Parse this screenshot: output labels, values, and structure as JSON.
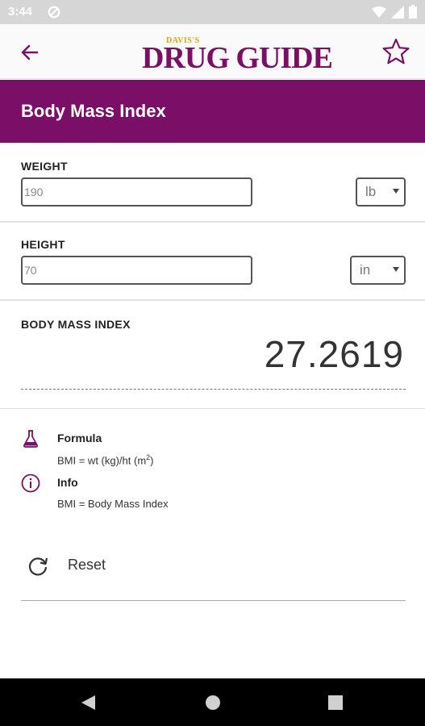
{
  "status_bar": {
    "time": "3:44"
  },
  "app_bar": {
    "logo_small": "DAVIS'S",
    "logo_main": "DRUG GUIDE"
  },
  "page": {
    "title": "Body Mass Index"
  },
  "weight": {
    "label": "WEIGHT",
    "value": "190",
    "unit": "lb"
  },
  "height": {
    "label": "HEIGHT",
    "value": "70",
    "unit": "in"
  },
  "result": {
    "label": "BODY MASS INDEX",
    "value": "27.2619"
  },
  "formula": {
    "title": "Formula",
    "text_prefix": "BMI = wt (kg)/ht (m",
    "text_sup": "2",
    "text_suffix": ")"
  },
  "info": {
    "title": "Info",
    "text": "BMI = Body Mass Index"
  },
  "reset": {
    "label": "Reset"
  },
  "colors": {
    "brand": "#7b0f67",
    "accent": "#e0a50f"
  }
}
